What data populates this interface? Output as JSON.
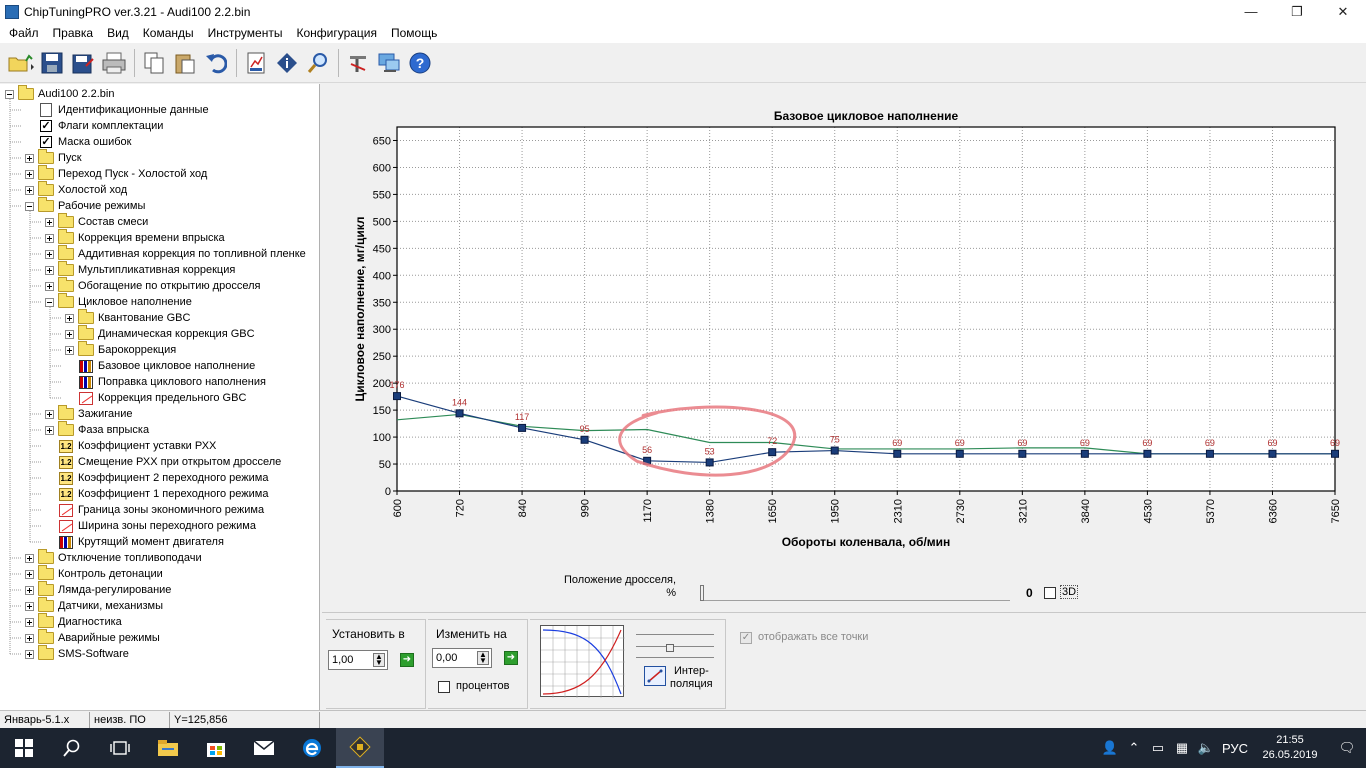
{
  "window": {
    "title": "ChipTuningPRO ver.3.21 - Audi100 2.2.bin",
    "minimize_glyph": "—",
    "maximize_glyph": "❐",
    "close_glyph": "✕"
  },
  "menu": [
    "Файл",
    "Правка",
    "Вид",
    "Команды",
    "Инструменты",
    "Конфигурация",
    "Помощь"
  ],
  "toolbar_icons": [
    "open-folder-icon",
    "save-icon",
    "save-as-icon",
    "print-icon",
    "copy-icon",
    "paste-icon",
    "undo-icon",
    "table-view-icon",
    "info-icon",
    "search-icon",
    "tools-icon",
    "network-icon",
    "help-icon"
  ],
  "tree": [
    {
      "label": "Audi100 2.2.bin",
      "level": 0,
      "exp": "minus",
      "icon": "folder"
    },
    {
      "label": "Идентификационные данные",
      "level": 1,
      "exp": "none",
      "icon": "doc"
    },
    {
      "label": "Флаги комплектации",
      "level": 1,
      "exp": "none",
      "icon": "check"
    },
    {
      "label": "Маска ошибок",
      "level": 1,
      "exp": "none",
      "icon": "check"
    },
    {
      "label": "Пуск",
      "level": 1,
      "exp": "plus",
      "icon": "folder"
    },
    {
      "label": "Переход Пуск - Холостой ход",
      "level": 1,
      "exp": "plus",
      "icon": "folder"
    },
    {
      "label": "Холостой ход",
      "level": 1,
      "exp": "plus",
      "icon": "folder"
    },
    {
      "label": "Рабочие режимы",
      "level": 1,
      "exp": "minus",
      "icon": "folder"
    },
    {
      "label": "Состав смеси",
      "level": 2,
      "exp": "plus",
      "icon": "folder"
    },
    {
      "label": "Коррекция времени впрыска",
      "level": 2,
      "exp": "plus",
      "icon": "folder"
    },
    {
      "label": "Аддитивная коррекция по топливной пленке",
      "level": 2,
      "exp": "plus",
      "icon": "folder"
    },
    {
      "label": "Мультипликативная коррекция",
      "level": 2,
      "exp": "plus",
      "icon": "folder"
    },
    {
      "label": "Обогащение по открытию дросселя",
      "level": 2,
      "exp": "plus",
      "icon": "folder"
    },
    {
      "label": "Цикловое наполнение",
      "level": 2,
      "exp": "minus",
      "icon": "folder"
    },
    {
      "label": "Квантование GBC",
      "level": 3,
      "exp": "plus",
      "icon": "folder"
    },
    {
      "label": "Динамическая коррекция GBC",
      "level": 3,
      "exp": "plus",
      "icon": "folder"
    },
    {
      "label": "Барокоррекция",
      "level": 3,
      "exp": "plus",
      "icon": "folder"
    },
    {
      "label": "Базовое цикловое наполнение",
      "level": 3,
      "exp": "none",
      "icon": "bar3d"
    },
    {
      "label": "Поправка циклового наполнения",
      "level": 3,
      "exp": "none",
      "icon": "bar3d"
    },
    {
      "label": "Коррекция предельного GBC",
      "level": 3,
      "exp": "none",
      "icon": "graph"
    },
    {
      "label": "Зажигание",
      "level": 2,
      "exp": "plus",
      "icon": "folder"
    },
    {
      "label": "Фаза впрыска",
      "level": 2,
      "exp": "plus",
      "icon": "folder"
    },
    {
      "label": "Коэффициент уставки РХХ",
      "level": 2,
      "exp": "none",
      "icon": "num"
    },
    {
      "label": "Смещение РХХ при открытом дросселе",
      "level": 2,
      "exp": "none",
      "icon": "num"
    },
    {
      "label": "Коэффициент 2 переходного режима",
      "level": 2,
      "exp": "none",
      "icon": "num"
    },
    {
      "label": "Коэффициент 1 переходного режима",
      "level": 2,
      "exp": "none",
      "icon": "num"
    },
    {
      "label": "Граница зоны экономичного режима",
      "level": 2,
      "exp": "none",
      "icon": "graph"
    },
    {
      "label": "Ширина зоны переходного режима",
      "level": 2,
      "exp": "none",
      "icon": "graph"
    },
    {
      "label": "Крутящий момент двигателя",
      "level": 2,
      "exp": "none",
      "icon": "bar3d"
    },
    {
      "label": "Отключение топливоподачи",
      "level": 1,
      "exp": "plus",
      "icon": "folder"
    },
    {
      "label": "Контроль детонации",
      "level": 1,
      "exp": "plus",
      "icon": "folder"
    },
    {
      "label": "Лямда-регулирование",
      "level": 1,
      "exp": "plus",
      "icon": "folder"
    },
    {
      "label": "Датчики, механизмы",
      "level": 1,
      "exp": "plus",
      "icon": "folder"
    },
    {
      "label": "Диагностика",
      "level": 1,
      "exp": "plus",
      "icon": "folder"
    },
    {
      "label": "Аварийные режимы",
      "level": 1,
      "exp": "plus",
      "icon": "folder"
    },
    {
      "label": "SMS-Software",
      "level": 1,
      "exp": "plus",
      "icon": "folder"
    }
  ],
  "chart_data": {
    "type": "line",
    "title": "Базовое цикловое наполнение",
    "xlabel": "Обороты коленвала, об/мин",
    "ylabel": "Цикловое наполнение, мг/цикл",
    "categories": [
      "600",
      "720",
      "840",
      "990",
      "1170",
      "1380",
      "1650",
      "1950",
      "2310",
      "2730",
      "3210",
      "3840",
      "4530",
      "5370",
      "6360",
      "7650"
    ],
    "ylim": [
      0,
      675
    ],
    "yticks": [
      0,
      50,
      100,
      150,
      200,
      250,
      300,
      350,
      400,
      450,
      500,
      550,
      600,
      650
    ],
    "grid": true,
    "series": [
      {
        "values": [
          176,
          144,
          117,
          95,
          56,
          53,
          72,
          75,
          69,
          69,
          69,
          69,
          69,
          69,
          69,
          69
        ],
        "color": "#1a3d7a",
        "point_labels": true
      },
      {
        "values": [
          132,
          142,
          120,
          112,
          114,
          90,
          90,
          78,
          78,
          78,
          80,
          80,
          69,
          69,
          69,
          69
        ],
        "color": "#2e8b57",
        "point_labels": false
      }
    ],
    "label_color": "#b03030",
    "annotation_color": "#e8787f"
  },
  "slider": {
    "label": "Положение дросселя, %",
    "value": "0",
    "fraction": 0,
    "label_3d": "3D"
  },
  "bottom": {
    "set_label": "Установить в",
    "set_value": "1,00",
    "change_label": "Изменить на",
    "change_value": "0,00",
    "percent_label": "процентов",
    "interp_label_1": "Интер-",
    "interp_label_2": "поляция",
    "show_all_label": "отображать все точки"
  },
  "status": {
    "cell1": "Январь-5.1.x",
    "cell2": "неизв. ПО",
    "cell3": "Y=125,856"
  },
  "taskbar": {
    "lang": "РУС",
    "time": "21:55",
    "date": "26.05.2019",
    "apps": [
      "start-icon",
      "search-icon",
      "task-view-icon",
      "file-explorer-icon",
      "store-icon",
      "mail-icon",
      "edge-icon",
      "chiptuning-icon"
    ]
  }
}
